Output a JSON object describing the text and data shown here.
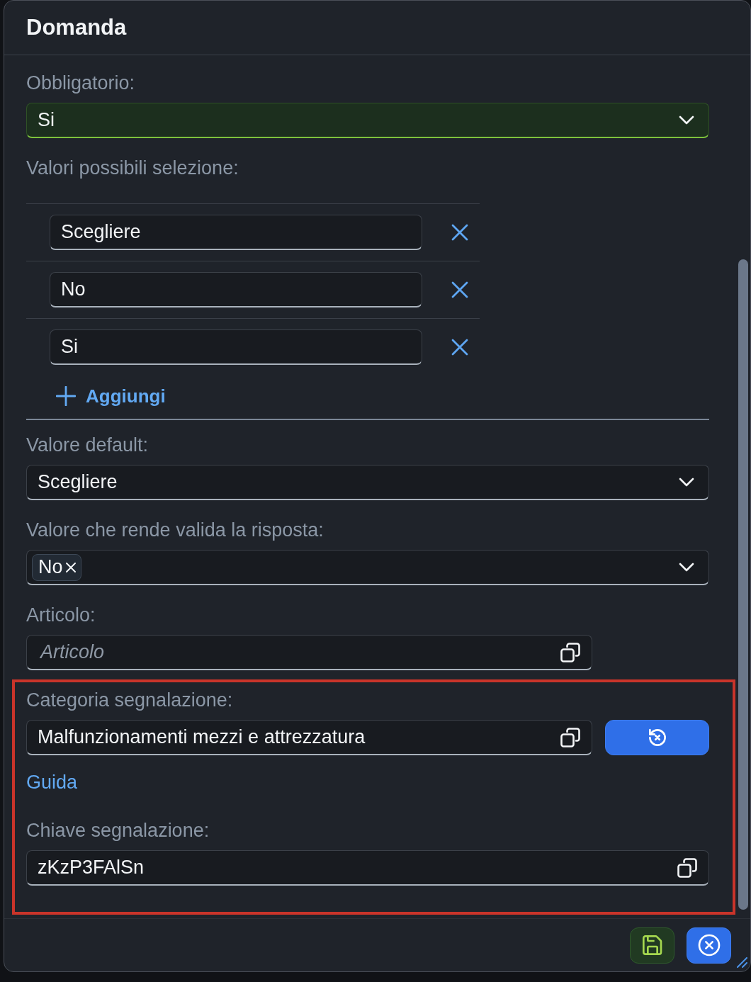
{
  "dialog": {
    "title": "Domanda"
  },
  "mandatory": {
    "label": "Obbligatorio:",
    "value": "Si",
    "valid": true
  },
  "possible_values": {
    "label": "Valori possibili selezione:",
    "items": [
      {
        "value": "Scegliere"
      },
      {
        "value": "No"
      },
      {
        "value": "Si"
      }
    ],
    "add_label": "Aggiungi"
  },
  "default_value": {
    "label": "Valore default:",
    "value": "Scegliere"
  },
  "valid_answer": {
    "label": "Valore che rende valida la risposta:",
    "tokens": [
      "No"
    ]
  },
  "article": {
    "label": "Articolo:",
    "placeholder": "Articolo"
  },
  "report_section": {
    "highlighted": true,
    "category": {
      "label": "Categoria segnalazione:",
      "value": "Malfunzionamenti mezzi e attrezzatura"
    },
    "guide_link": "Guida",
    "key": {
      "label": "Chiave segnalazione:",
      "value": "zKzP3FAlSn"
    }
  }
}
